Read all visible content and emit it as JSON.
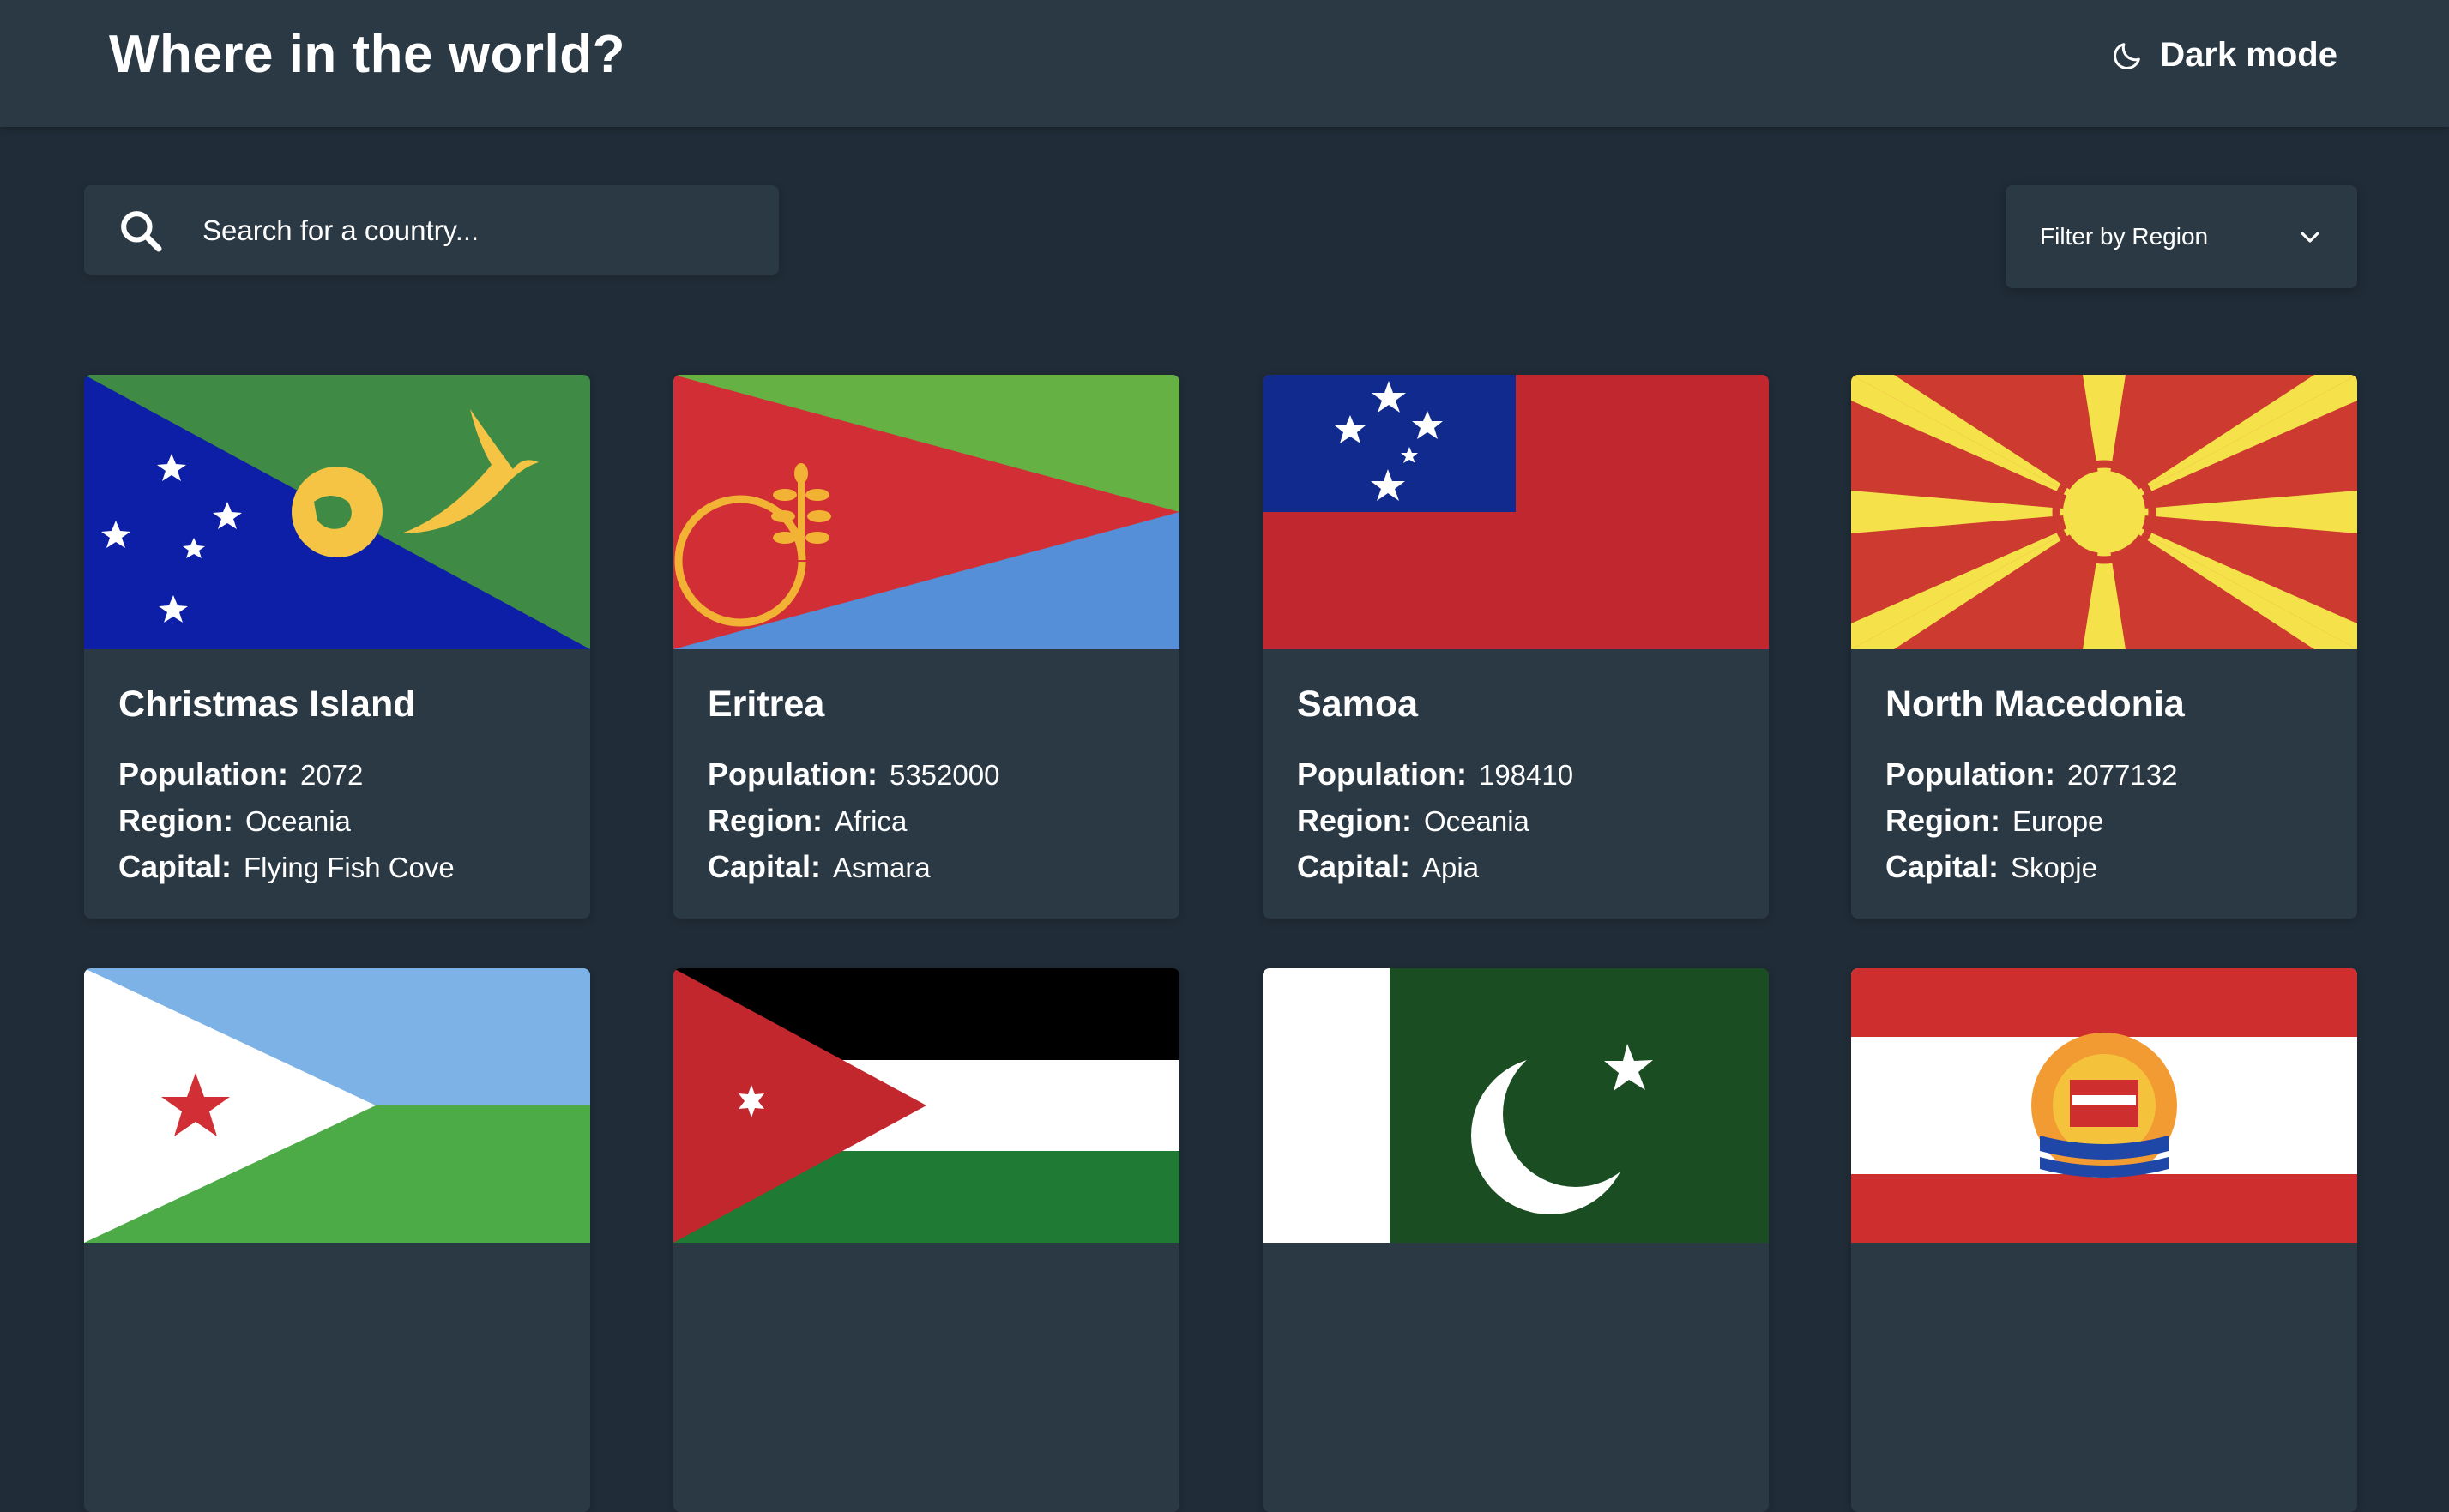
{
  "header": {
    "title": "Where in the world?",
    "theme_toggle_label": "Dark mode",
    "theme_icon": "moon-icon"
  },
  "search": {
    "placeholder": "Search for a country...",
    "value": "",
    "icon": "search-icon"
  },
  "filter": {
    "label": "Filter by Region",
    "icon": "chevron-down-icon"
  },
  "labels": {
    "population": "Population:",
    "region": "Region:",
    "capital": "Capital:"
  },
  "countries": [
    {
      "name": "Christmas Island",
      "population": "2072",
      "region": "Oceania",
      "capital": "Flying Fish Cove"
    },
    {
      "name": "Eritrea",
      "population": "5352000",
      "region": "Africa",
      "capital": "Asmara"
    },
    {
      "name": "Samoa",
      "population": "198410",
      "region": "Oceania",
      "capital": "Apia"
    },
    {
      "name": "North Macedonia",
      "population": "2077132",
      "region": "Europe",
      "capital": "Skopje"
    },
    {
      "name": "",
      "population": "",
      "region": "",
      "capital": ""
    },
    {
      "name": "",
      "population": "",
      "region": "",
      "capital": ""
    },
    {
      "name": "",
      "population": "",
      "region": "",
      "capital": ""
    },
    {
      "name": "",
      "population": "",
      "region": "",
      "capital": ""
    }
  ],
  "colors": {
    "background": "#202c37",
    "elements": "#2b3945",
    "text": "#ffffff"
  }
}
